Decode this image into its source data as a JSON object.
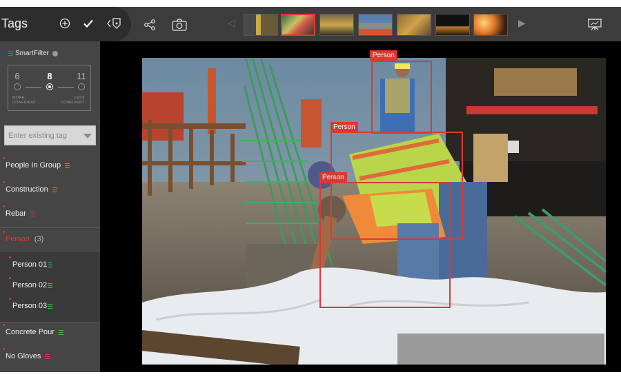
{
  "header": {
    "title": "Tags",
    "icons": [
      "add-circle-icon",
      "checkmark-icon",
      "back-tag-icon",
      "share-icon",
      "camera-icon",
      "presentation-icon"
    ]
  },
  "filmstrip": {
    "prev_arrow": "◁",
    "next_arrow": "▶",
    "selected_index": 1
  },
  "smartfilter": {
    "title": "SmartFilter",
    "levels": [
      "6",
      "8",
      "11"
    ],
    "selected": "8",
    "captions": {
      "more": "MORE\nCONFIDENT",
      "less": "LESS\nCONFIDENT"
    }
  },
  "tag_search": {
    "placeholder": "Enter existing tag"
  },
  "tags": {
    "people_in_group": "People In Group",
    "construction": "Construction",
    "rebar": "Rebar",
    "person": "Person",
    "person_count": "(3)",
    "person_01": "Person 01",
    "person_02": "Person 02",
    "person_03": "Person 03",
    "concrete_pour": "Concrete Pour",
    "no_gloves": "No Gloves"
  },
  "detections": [
    {
      "label": "Person"
    },
    {
      "label": "Person"
    },
    {
      "label": "Person"
    }
  ],
  "colors": {
    "accent_red": "#e0392f",
    "positive_green": "#3fbf5a",
    "topbar": "#3c3c3c",
    "sidebar": "#454545"
  }
}
